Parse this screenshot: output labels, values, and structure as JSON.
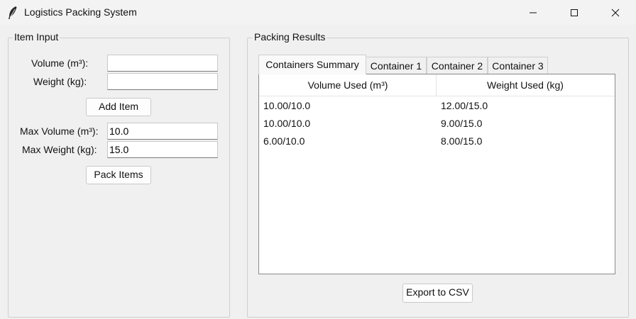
{
  "window": {
    "title": "Logistics Packing System",
    "icon": "feather-icon"
  },
  "item_input": {
    "frame_label": "Item Input",
    "volume_label": "Volume (m³):",
    "volume_value": "",
    "weight_label": "Weight (kg):",
    "weight_value": "",
    "add_button": "Add Item",
    "max_volume_label": "Max Volume (m³):",
    "max_volume_value": "10.0",
    "max_weight_label": "Max Weight (kg):",
    "max_weight_value": "15.0",
    "pack_button": "Pack Items"
  },
  "results": {
    "frame_label": "Packing Results",
    "tabs": [
      {
        "label": "Containers Summary",
        "active": true
      },
      {
        "label": "Container 1",
        "active": false
      },
      {
        "label": "Container 2",
        "active": false
      },
      {
        "label": "Container 3",
        "active": false
      }
    ],
    "columns": [
      "Volume Used (m³)",
      "Weight Used (kg)"
    ],
    "rows": [
      [
        "10.00/10.0",
        "12.00/15.0"
      ],
      [
        "10.00/10.0",
        "9.00/15.0"
      ],
      [
        "6.00/10.0",
        "8.00/15.0"
      ]
    ],
    "export_button": "Export to CSV"
  }
}
